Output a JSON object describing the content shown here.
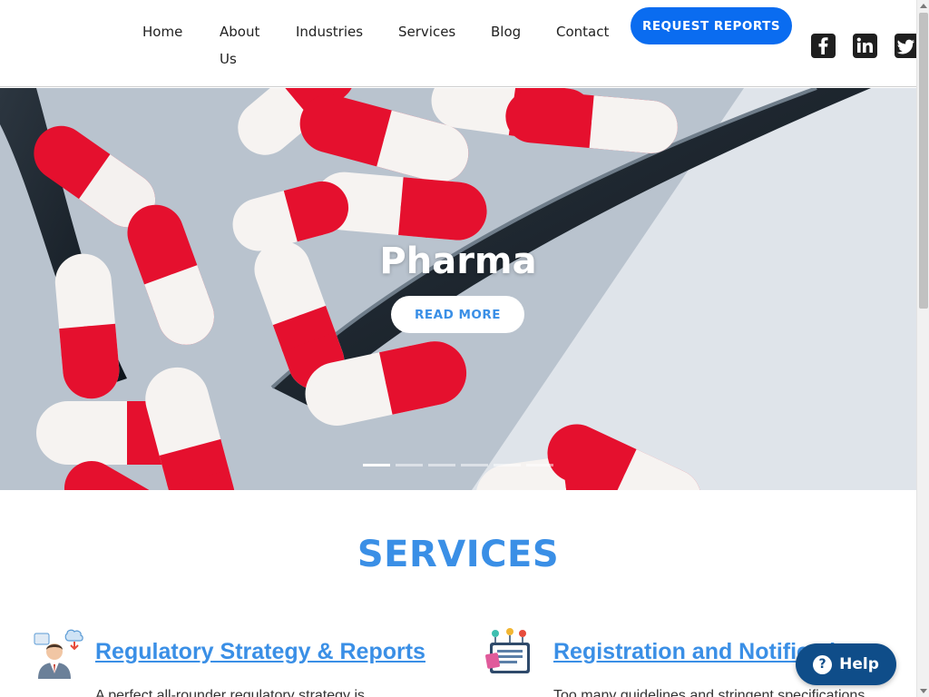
{
  "nav": {
    "items": [
      {
        "label": "Home"
      },
      {
        "label": "About Us"
      },
      {
        "label": "Industries"
      },
      {
        "label": "Services"
      },
      {
        "label": "Blog"
      },
      {
        "label": "Contact"
      }
    ],
    "cta_label": "REQUEST REPORTS",
    "social_icons": [
      "facebook-icon",
      "linkedin-icon",
      "twitter-icon"
    ]
  },
  "hero": {
    "title": "Pharma",
    "button_label": "READ MORE",
    "slide_count": 6,
    "active_slide": 1
  },
  "services": {
    "heading": "SERVICES",
    "items": [
      {
        "title": "Regulatory Strategy & Reports",
        "desc": "A perfect all-rounder regulatory strategy is",
        "icon": "consultant-icon"
      },
      {
        "title": "Registration and Notifications",
        "desc": "Too many guidelines and stringent specifications",
        "icon": "document-icon"
      }
    ]
  },
  "help": {
    "label": "Help"
  },
  "colors": {
    "accent": "#3a8fe6",
    "cta": "#0a6cf0",
    "help": "#0f4d89"
  }
}
